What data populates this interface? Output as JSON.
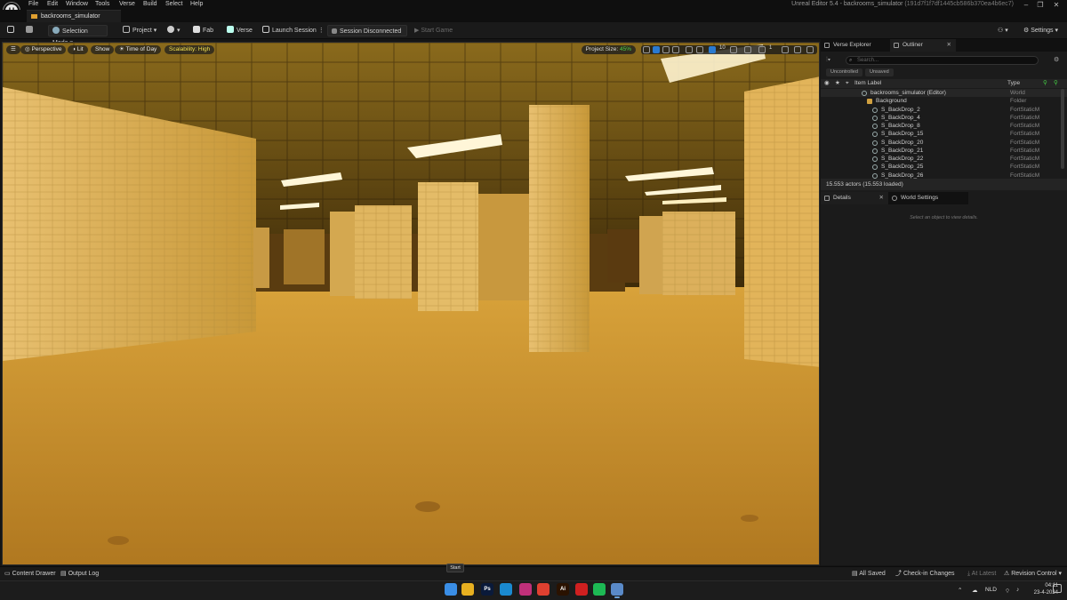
{
  "menubar": {
    "items": [
      "File",
      "Edit",
      "Window",
      "Tools",
      "Verse",
      "Build",
      "Select",
      "Help"
    ],
    "title": "Unreal Editor 5.4 - backrooms_simulator",
    "title_hash": "(191d7f1f7df1445cb586b370ea4b6ec7)",
    "logo": "unreal-logo"
  },
  "document_tab": {
    "label": "backrooms_simulator"
  },
  "toolbar": {
    "selection_mode": "Selection Mode",
    "project": "Project",
    "fab": "Fab",
    "verse": "Verse",
    "launch_session": "Launch Session",
    "session_status": "Session Disconnected",
    "start_game": "Start Game",
    "settings": "Settings"
  },
  "viewport": {
    "perspective": "Perspective",
    "lit": "Lit",
    "show": "Show",
    "time_of_day": "Time of Day",
    "scalability": "Scalability: High",
    "project_size_label": "Project Size:",
    "project_size_value": "45%",
    "snap_value": "10",
    "camera_speed": "1"
  },
  "panels": {
    "verse_explorer": "Verse Explorer",
    "outliner": "Outliner",
    "search_placeholder": "Search...",
    "chips": [
      "Uncontrolled",
      "Unsaved"
    ],
    "col_label": "Item Label",
    "col_type": "Type",
    "rows": [
      {
        "label": "backrooms_simulator (Editor)",
        "type": "World"
      },
      {
        "label": "Background",
        "type": "Folder"
      },
      {
        "label": "S_BackDrop_2",
        "type": "FortStaticM"
      },
      {
        "label": "S_BackDrop_4",
        "type": "FortStaticM"
      },
      {
        "label": "S_BackDrop_8",
        "type": "FortStaticM"
      },
      {
        "label": "S_BackDrop_15",
        "type": "FortStaticM"
      },
      {
        "label": "S_BackDrop_20",
        "type": "FortStaticM"
      },
      {
        "label": "S_BackDrop_21",
        "type": "FortStaticM"
      },
      {
        "label": "S_BackDrop_22",
        "type": "FortStaticM"
      },
      {
        "label": "S_BackDrop_25",
        "type": "FortStaticM"
      },
      {
        "label": "S_BackDrop_26",
        "type": "FortStaticM"
      }
    ],
    "actors_count": "15.553 actors (15.553 loaded)",
    "details": "Details",
    "world_settings": "World Settings",
    "details_empty": "Select an object to view details."
  },
  "status": {
    "content_drawer": "Content Drawer",
    "output_log": "Output Log",
    "start_tooltip": "Start",
    "all_saved": "All Saved",
    "checkin": "Check-in Changes",
    "at_latest": "At Latest",
    "revision_control": "Revision Control"
  },
  "taskbar": {
    "apps": [
      {
        "name": "start",
        "label": "",
        "color": "#3a8ee6"
      },
      {
        "name": "file-explorer",
        "label": "",
        "color": "#e8b020"
      },
      {
        "name": "photoshop",
        "label": "Ps",
        "color": "#0a1a3a"
      },
      {
        "name": "edge",
        "label": "",
        "color": "#1a8ad0"
      },
      {
        "name": "instagram",
        "label": "",
        "color": "#c0307a"
      },
      {
        "name": "chrome",
        "label": "",
        "color": "#e04030"
      },
      {
        "name": "illustrator",
        "label": "Ai",
        "color": "#2a1200"
      },
      {
        "name": "bolt",
        "label": "",
        "color": "#d02020"
      },
      {
        "name": "spotify",
        "label": "",
        "color": "#1db954"
      },
      {
        "name": "unreal",
        "label": "",
        "color": "#5a8ac8"
      }
    ],
    "lang": "NLD",
    "time": "04:11",
    "date": "23-4-2024"
  }
}
